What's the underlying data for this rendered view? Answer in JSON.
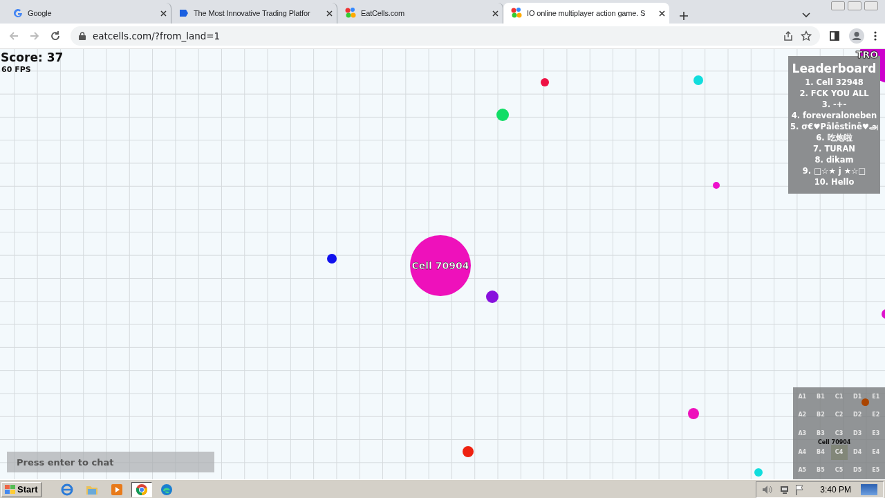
{
  "browser": {
    "tabs": [
      {
        "title": "Google",
        "selected": false
      },
      {
        "title": "The Most Innovative Trading Platfor",
        "selected": false
      },
      {
        "title": "EatCells.com",
        "selected": false
      },
      {
        "title": "IO online multiplayer action game. S",
        "selected": true
      }
    ],
    "url": "eatcells.com/?from_land=1"
  },
  "game": {
    "score": "Score: 37",
    "fps": "60 FPS",
    "player": {
      "name": "Cell 70904",
      "color": "#ee11bb"
    },
    "other_cell": {
      "name": "TRO",
      "color": "#cc00cc"
    },
    "pellets": [
      {
        "color": "#ee1144"
      },
      {
        "color": "#11dddd"
      },
      {
        "color": "#11dd66"
      },
      {
        "color": "#ee11cc"
      },
      {
        "color": "#1111ee"
      },
      {
        "color": "#8811dd"
      },
      {
        "color": "#ee11bb"
      },
      {
        "color": "#ee2211"
      },
      {
        "color": "#11dddd"
      },
      {
        "color": "#dd11cc"
      }
    ],
    "leaderboard": {
      "title": "Leaderboard",
      "entries": [
        "1. Cell 32948",
        "2. FCK YOU ALL",
        "3. -+-",
        "4. foreveraloneben",
        "5. σ€♥Pālēstinē♥அ",
        "6. 吃炮啦",
        "7. TURAN",
        "8. dikam",
        "9. □☆★ j ★☆□",
        "10. Hello"
      ]
    },
    "minimap": {
      "labels": [
        "A1",
        "B1",
        "C1",
        "D1",
        "E1",
        "A2",
        "B2",
        "C2",
        "D2",
        "E2",
        "A3",
        "B3",
        "C3",
        "D3",
        "E3",
        "A4",
        "B4",
        "C4",
        "D4",
        "E4",
        "A5",
        "B5",
        "C5",
        "D5",
        "E5"
      ],
      "player": "Cell 70904",
      "dot": {
        "color": "#aa4400"
      }
    },
    "chat": {
      "placeholder": "Press enter to chat"
    }
  },
  "taskbar": {
    "start": "Start",
    "apps": [
      {
        "selected": false
      },
      {
        "selected": false
      },
      {
        "selected": false
      },
      {
        "selected": true
      },
      {
        "selected": false
      }
    ],
    "clock": "3:40 PM"
  }
}
